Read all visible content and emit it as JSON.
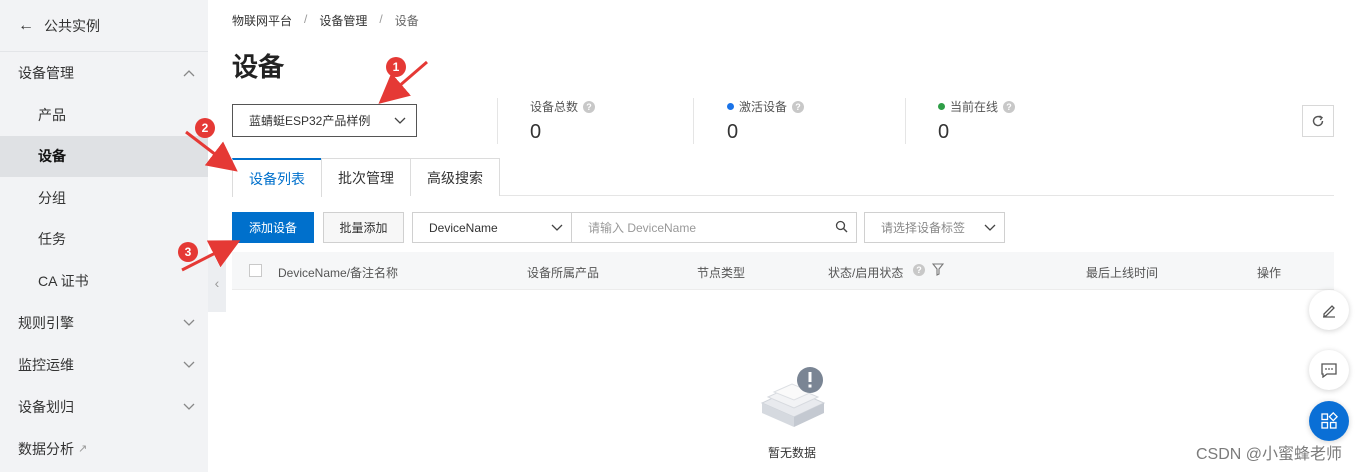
{
  "sidebar": {
    "back_label": "公共实例",
    "groups": [
      {
        "label": "设备管理",
        "expanded": true
      },
      {
        "label": "规则引擎",
        "expanded": false
      },
      {
        "label": "监控运维",
        "expanded": false
      },
      {
        "label": "设备划归",
        "expanded": false
      },
      {
        "label": "数据分析",
        "expanded": false
      }
    ],
    "sub_items": [
      "产品",
      "设备",
      "分组",
      "任务",
      "CA 证书"
    ],
    "active_item": "设备"
  },
  "breadcrumb": [
    "物联网平台",
    "设备管理",
    "设备"
  ],
  "page_title": "设备",
  "product_select": {
    "value": "蓝蜻蜓ESP32产品样例"
  },
  "stats": [
    {
      "label": "设备总数",
      "value": "0"
    },
    {
      "label": "激活设备",
      "value": "0",
      "dot_color": "#1a73e8"
    },
    {
      "label": "当前在线",
      "value": "0",
      "dot_color": "#2e9e47"
    }
  ],
  "tabs": [
    "设备列表",
    "批次管理",
    "高级搜索"
  ],
  "active_tab": "设备列表",
  "toolbar": {
    "add_device": "添加设备",
    "batch_add": "批量添加",
    "field_select": "DeviceName",
    "search_placeholder": "请输入 DeviceName",
    "tag_placeholder": "请选择设备标签"
  },
  "table": {
    "columns": [
      "DeviceName/备注名称",
      "设备所属产品",
      "节点类型",
      "状态/启用状态",
      "最后上线时间",
      "操作"
    ]
  },
  "empty_state": {
    "text": "暂无数据"
  },
  "annotations": [
    "1",
    "2",
    "3"
  ],
  "watermark": "CSDN @小蜜蜂老师",
  "colors": {
    "primary": "#0070cc",
    "annotation": "#e53935",
    "sidebar_bg": "#f2f3f5"
  }
}
